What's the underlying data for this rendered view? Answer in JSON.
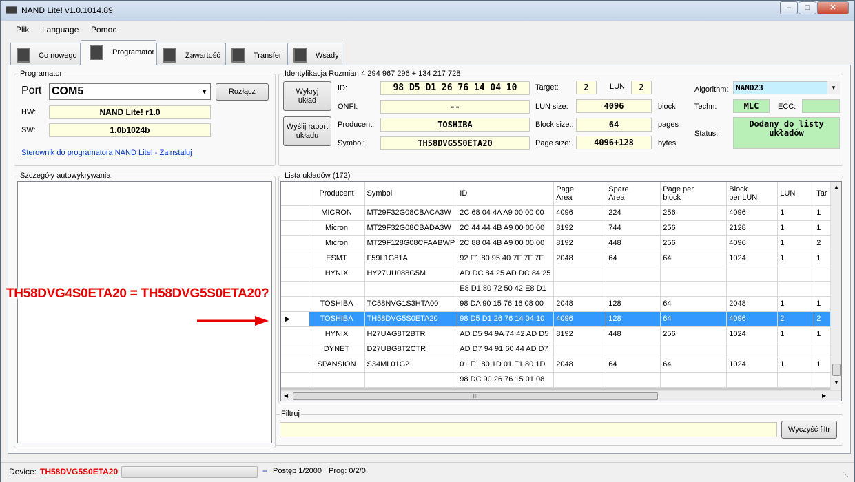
{
  "window": {
    "title": "NAND Lite! v1.0.1014.89"
  },
  "menu": [
    "Plik",
    "Language",
    "Pomoc"
  ],
  "tabs": [
    "Co nowego",
    "Programator",
    "Zawartość",
    "Transfer",
    "Wsady"
  ],
  "programmer": {
    "group_label": "Programator",
    "port_label": "Port",
    "port_value": "COM5",
    "disconnect_button": "Rozłącz",
    "hw_label": "HW:",
    "hw_value": "NAND Lite! r1.0",
    "sw_label": "SW:",
    "sw_value": "1.0b1024b",
    "driver_link": "Sterownik do programatora NAND Lite! - Zainstaluj"
  },
  "ident": {
    "group_label": "Identyfikacja Rozmiar: 4 294 967 296 +  134 217 728",
    "detect_button": "Wykryj\nukład",
    "report_button": "Wyślij raport\nukładu",
    "id_label": "ID:",
    "id_value": "98 D5 D1 26 76 14 04 10",
    "onfi_label": "ONFI:",
    "onfi_value": "--",
    "producer_label": "Producent:",
    "producer_value": "TOSHIBA",
    "symbol_label": "Symbol:",
    "symbol_value": "TH58DVG5S0ETA20",
    "target_label": "Target:",
    "target_value": "2",
    "lun_label": "LUN",
    "lun_value": "2",
    "lunsize_label": "LUN size:",
    "lunsize_value": "4096",
    "lunsize_unit": "block",
    "blocksize_label": "Block size::",
    "blocksize_value": "64",
    "blocksize_unit": "pages",
    "pagesize_label": "Page size:",
    "pagesize_value": "4096+128",
    "pagesize_unit": "bytes",
    "algorithm_label": "Algorithm:",
    "algorithm_value": "NAND23",
    "techn_label": "Techn:",
    "techn_value": "MLC",
    "ecc_label": "ECC:",
    "ecc_value": "",
    "status_label": "Status:",
    "status_value": "Dodany do listy\nukładów"
  },
  "details": {
    "group_label": "Szczegóły autowykrywania"
  },
  "chiplist": {
    "group_label": "Lista układów (172)",
    "columns": [
      "Producent",
      "Symbol",
      "ID",
      "Page\nArea",
      "Spare\nArea",
      "Page per\nblock",
      "Block\nper LUN",
      "LUN",
      "Tar"
    ],
    "rows": [
      [
        "MICRON",
        "MT29F32G08CBACA3W",
        "2C 68 04 4A A9 00 00 00",
        "4096",
        "224",
        "256",
        "4096",
        "1",
        "1"
      ],
      [
        "Micron",
        "MT29F32G08CBADA3W",
        "2C 44 44 4B A9 00 00 00",
        "8192",
        "744",
        "256",
        "2128",
        "1",
        "1"
      ],
      [
        "Micron",
        "MT29F128G08CFAABWP",
        "2C 88 04 4B A9 00 00 00",
        "8192",
        "448",
        "256",
        "4096",
        "1",
        "2"
      ],
      [
        "ESMT",
        "F59L1G81A",
        "92 F1 80 95 40 7F 7F 7F",
        "2048",
        "64",
        "64",
        "1024",
        "1",
        "1"
      ],
      [
        "HYNIX",
        "HY27UU088G5M",
        "AD DC 84 25 AD DC 84 25",
        "",
        "",
        "",
        "",
        "",
        ""
      ],
      [
        "",
        "",
        "E8 D1 80 72 50 42 E8 D1",
        "",
        "",
        "",
        "",
        "",
        ""
      ],
      [
        "TOSHIBA",
        "TC58NVG1S3HTA00",
        "98 DA 90 15 76 16 08 00",
        "2048",
        "128",
        "64",
        "2048",
        "1",
        "1"
      ],
      [
        "TOSHIBA",
        "TH58DVG5S0ETA20",
        "98 D5 D1 26 76 14 04 10",
        "4096",
        "128",
        "64",
        "4096",
        "2",
        "2"
      ],
      [
        "HYNIX",
        "H27UAG8T2BTR",
        "AD D5 94 9A 74 42 AD D5",
        "8192",
        "448",
        "256",
        "1024",
        "1",
        "1"
      ],
      [
        "DYNET",
        "D27UBG8T2CTR",
        "AD D7 94 91 60 44 AD D7",
        "",
        "",
        "",
        "",
        "",
        ""
      ],
      [
        "SPANSION",
        "S34ML01G2",
        "01 F1 80 1D 01 F1 80 1D",
        "2048",
        "64",
        "64",
        "1024",
        "1",
        "1"
      ],
      [
        "",
        "",
        "98 DC 90 26 76 15 01 08",
        "",
        "",
        "",
        "",
        "",
        ""
      ]
    ],
    "selected_index": 7,
    "hscroll_mark": "III"
  },
  "filter": {
    "group_label": "Filtruj",
    "value": "",
    "clear_button": "Wyczyść filtr"
  },
  "status": {
    "device_label": "Device:",
    "device_value": "TH58DVG5S0ETA20",
    "progress": 0,
    "dashes": "--",
    "progress_text": "Postęp 1/2000",
    "prog_text": "Prog: 0/2/0"
  },
  "annotation": {
    "text": "TH58DVG4S0ETA20 = TH58DVG5S0ETA20?",
    "color": "#e60000"
  }
}
